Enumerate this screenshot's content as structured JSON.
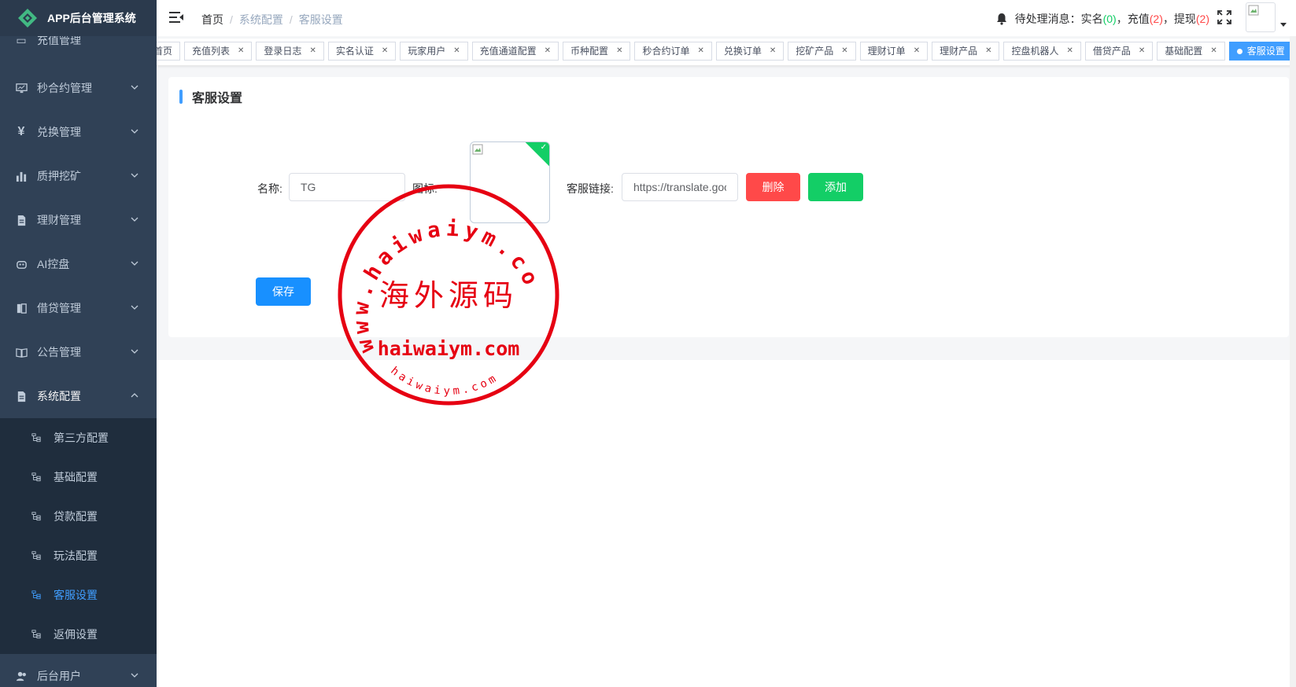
{
  "app": {
    "title": "APP后台管理系统"
  },
  "sidebar": {
    "partial_item": "充值管理",
    "items": [
      {
        "label": "秒合约管理",
        "icon": "monitor-icon"
      },
      {
        "label": "兑换管理",
        "icon": "yen-icon"
      },
      {
        "label": "质押挖矿",
        "icon": "bar-chart-icon"
      },
      {
        "label": "理财管理",
        "icon": "document-icon"
      },
      {
        "label": "AI控盘",
        "icon": "robot-icon"
      },
      {
        "label": "借贷管理",
        "icon": "book-icon"
      },
      {
        "label": "公告管理",
        "icon": "open-book-icon"
      },
      {
        "label": "系统配置",
        "icon": "document-icon"
      }
    ],
    "submenu": [
      {
        "label": "第三方配置",
        "active": false
      },
      {
        "label": "基础配置",
        "active": false
      },
      {
        "label": "贷款配置",
        "active": false
      },
      {
        "label": "玩法配置",
        "active": false
      },
      {
        "label": "客服设置",
        "active": true
      },
      {
        "label": "返佣设置",
        "active": false
      }
    ],
    "bottom_item": {
      "label": "后台用户",
      "icon": "users-icon"
    }
  },
  "header": {
    "breadcrumb": [
      "首页",
      "系统配置",
      "客服设置"
    ],
    "notice": {
      "prefix": "待处理消息：",
      "realname_label": "实名",
      "realname_count": "0",
      "recharge_label": "充值",
      "recharge_count": "2",
      "withdraw_label": "提现",
      "withdraw_count": "2"
    }
  },
  "tags": [
    {
      "label": "首页",
      "closable": false,
      "active": false
    },
    {
      "label": "充值列表",
      "closable": true,
      "active": false
    },
    {
      "label": "登录日志",
      "closable": true,
      "active": false
    },
    {
      "label": "实名认证",
      "closable": true,
      "active": false
    },
    {
      "label": "玩家用户",
      "closable": true,
      "active": false
    },
    {
      "label": "充值通道配置",
      "closable": true,
      "active": false
    },
    {
      "label": "币种配置",
      "closable": true,
      "active": false
    },
    {
      "label": "秒合约订单",
      "closable": true,
      "active": false
    },
    {
      "label": "兑换订单",
      "closable": true,
      "active": false
    },
    {
      "label": "挖矿产品",
      "closable": true,
      "active": false
    },
    {
      "label": "理财订单",
      "closable": true,
      "active": false
    },
    {
      "label": "理财产品",
      "closable": true,
      "active": false
    },
    {
      "label": "控盘机器人",
      "closable": true,
      "active": false
    },
    {
      "label": "借贷产品",
      "closable": true,
      "active": false
    },
    {
      "label": "基础配置",
      "closable": true,
      "active": false
    },
    {
      "label": "客服设置",
      "closable": true,
      "active": true
    }
  ],
  "page": {
    "title": "客服设置",
    "form": {
      "name_label": "名称:",
      "name_value": "TG",
      "icon_label": "图标:",
      "link_label": "客服链接:",
      "link_value": "https://translate.goo",
      "delete_label": "删除",
      "add_label": "添加",
      "save_label": "保存"
    }
  },
  "watermark": {
    "center_text": "海外源码",
    "ring_text": "www.haiwaiym.com",
    "line_text": "haiwaiym.com",
    "small_text": "haiwaiym.com",
    "color": "#e60012"
  },
  "colors": {
    "sidebar_bg": "#304156",
    "submenu_bg": "#1f2d3d",
    "accent": "#409eff",
    "danger": "#ff4949",
    "success": "#13ce66"
  }
}
